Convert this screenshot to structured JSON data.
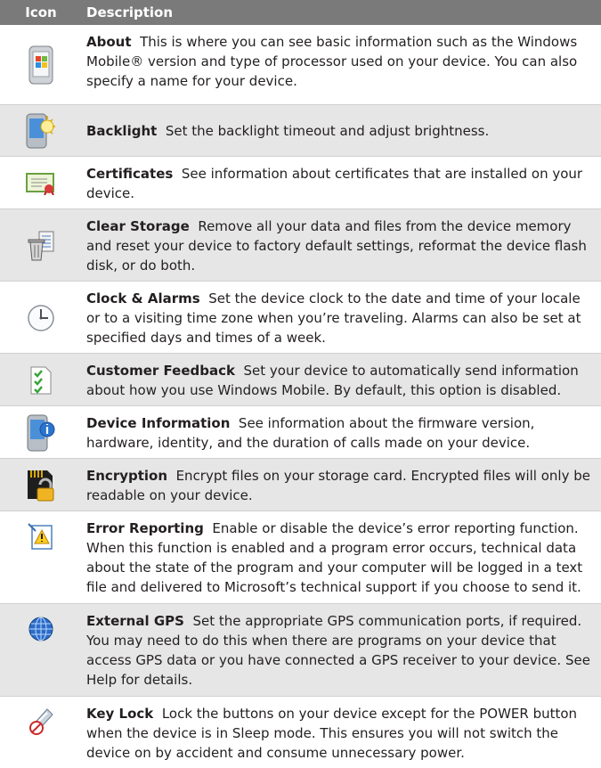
{
  "header": {
    "icon": "Icon",
    "description": "Description"
  },
  "rows": [
    {
      "icon": "windows-device-icon",
      "title": "About",
      "text": "This is where you can see basic information such as the Windows Mobile® version and type of processor used on your device. You can also specify a name for your device."
    },
    {
      "icon": "backlight-icon",
      "title": "Backlight",
      "text": "Set the backlight timeout and adjust brightness."
    },
    {
      "icon": "certificate-icon",
      "title": "Certificates",
      "text": "See information about certificates that are installed on your device."
    },
    {
      "icon": "clear-storage-icon",
      "title": "Clear Storage",
      "text": "Remove all your data and files from the device memory and reset your device to factory default settings, reformat the device flash disk, or do both."
    },
    {
      "icon": "clock-icon",
      "title": "Clock & Alarms",
      "text": "Set the device clock to the date and time of your locale or to a visiting time zone when you’re traveling. Alarms can also be set at specified days and times of a week."
    },
    {
      "icon": "feedback-icon",
      "title": "Customer Feedback",
      "text": "Set your device to automatically send information about how you use Windows Mobile. By default, this option is disabled."
    },
    {
      "icon": "device-info-icon",
      "title": "Device Information",
      "text": "See information about the firmware version, hardware, identity, and the duration of calls made on your device."
    },
    {
      "icon": "encryption-icon",
      "title": "Encryption",
      "text": "Encrypt files on your storage card. Encrypted files will only be readable on your device."
    },
    {
      "icon": "error-reporting-icon",
      "title": "Error Reporting",
      "text": "Enable or disable the device’s error reporting function. When this function is enabled and a program error occurs, technical data about the state of the program and your computer will be logged in a text file and delivered to Microsoft’s technical support if you choose to send it."
    },
    {
      "icon": "gps-globe-icon",
      "title": "External GPS",
      "text": "Set the appropriate GPS communication ports, if required. You may need to do this when there are programs on your device that access GPS data or you have connected a GPS receiver to your device. See Help for details."
    },
    {
      "icon": "key-lock-icon",
      "title": "Key Lock",
      "text": "Lock the buttons on your device except for the POWER button when the device is in Sleep mode. This ensures you will not switch the device on by accident and consume unnecessary power."
    }
  ]
}
